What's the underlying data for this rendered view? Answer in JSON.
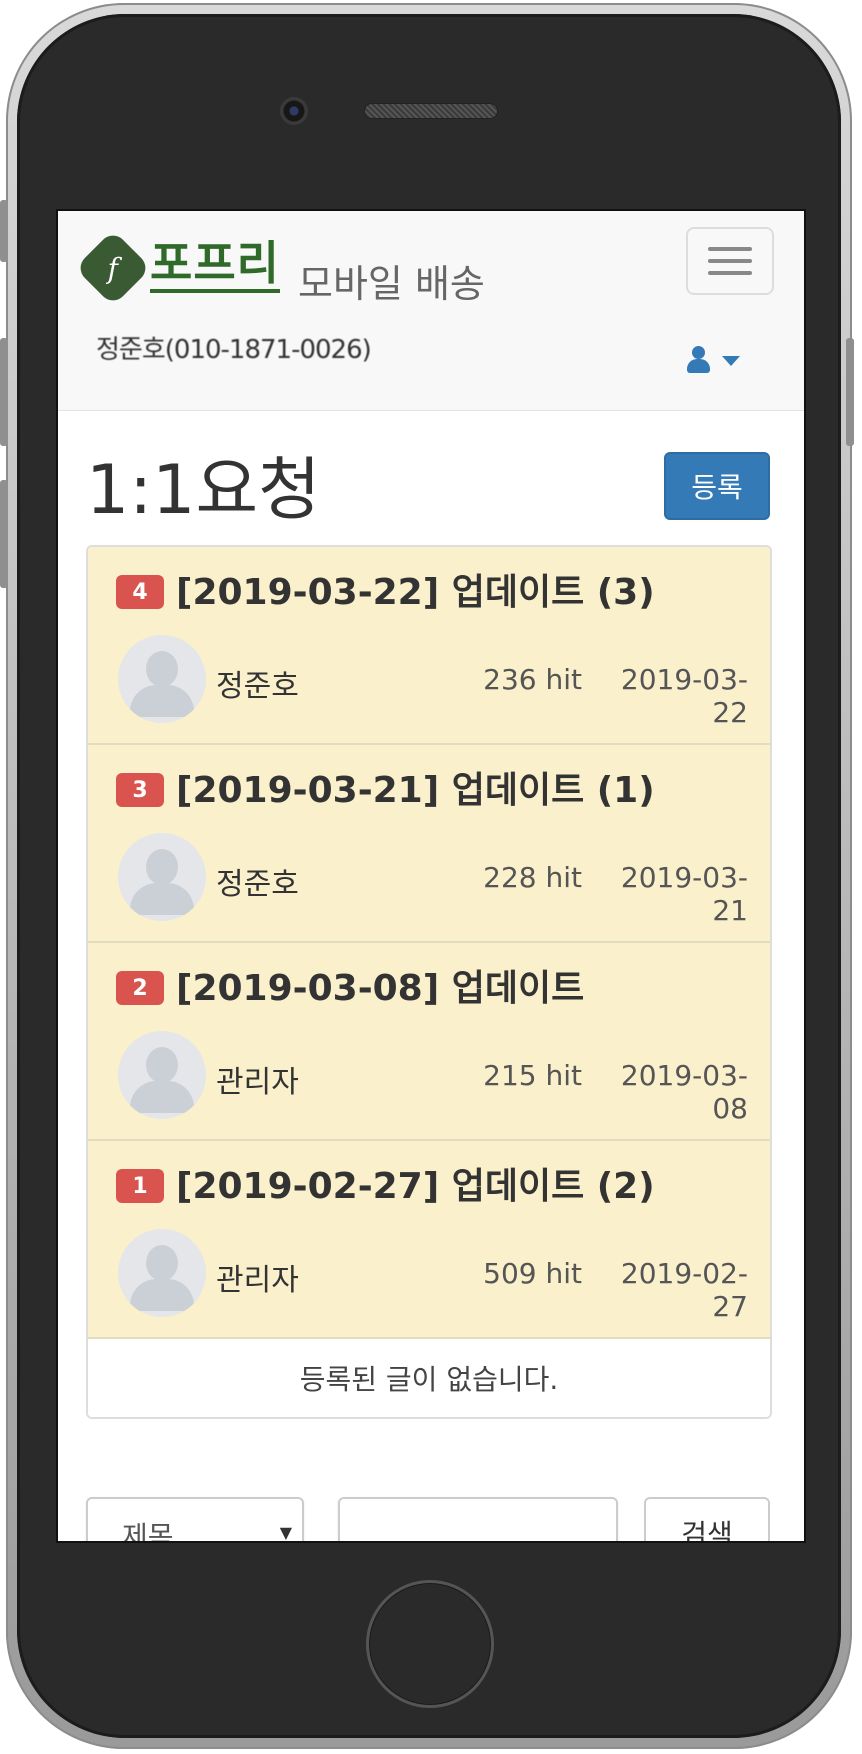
{
  "header": {
    "brand_logo_glyph": "𝑓",
    "brand_name": "포프리",
    "brand_subtitle": "모바일 배송",
    "user_display": "정준호(010-1871-0026)"
  },
  "main": {
    "title": "1:1요청",
    "register_label": "등록",
    "posts": [
      {
        "num": "4",
        "title": "[2019-03-22] 업데이트 (3)",
        "author": "정준호",
        "hits": "236 hit",
        "date": "2019-03-22"
      },
      {
        "num": "3",
        "title": "[2019-03-21] 업데이트 (1)",
        "author": "정준호",
        "hits": "228 hit",
        "date": "2019-03-21"
      },
      {
        "num": "2",
        "title": "[2019-03-08] 업데이트",
        "author": "관리자",
        "hits": "215 hit",
        "date": "2019-03-08"
      },
      {
        "num": "1",
        "title": "[2019-02-27] 업데이트 (2)",
        "author": "관리자",
        "hits": "509 hit",
        "date": "2019-02-27"
      }
    ],
    "empty_message": "등록된 글이 없습니다."
  },
  "search": {
    "field_selected": "제목",
    "query_value": "",
    "button_label": "검색"
  },
  "colors": {
    "primary": "#337ab7",
    "badge": "#d9534f",
    "row_highlight": "#faf0cc",
    "brand_green": "#2f6a2a"
  }
}
